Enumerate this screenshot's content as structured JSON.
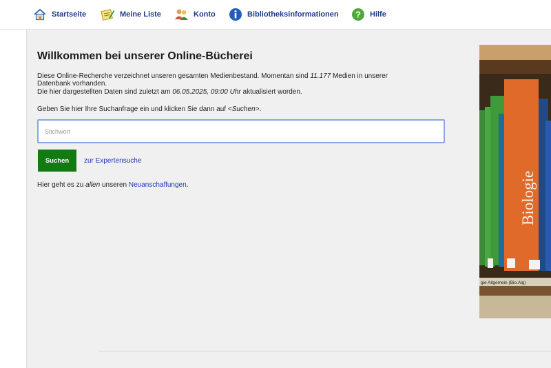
{
  "nav": {
    "items": [
      {
        "label": "Startseite",
        "icon": "home-icon"
      },
      {
        "label": "Meine Liste",
        "icon": "notepad-icon"
      },
      {
        "label": "Konto",
        "icon": "users-icon"
      },
      {
        "label": "Bibliotheksinformationen",
        "icon": "info-icon"
      },
      {
        "label": "Hilfe",
        "icon": "help-icon"
      }
    ]
  },
  "main": {
    "title": "Willkommen bei unserer Online-Bücherei",
    "intro_part1": "Diese Online-Recherche verzeichnet unseren gesamten Medienbestand. Momentan sind ",
    "media_count": "11.177",
    "intro_part2": " Medien in unserer Datenbank vorhanden.",
    "updated_part1": "Die hier dargestellten Daten sind zuletzt am ",
    "updated_datetime": "06.05.2025, 09:00 Uhr",
    "updated_part2": " aktualisiert worden.",
    "instruction_part1": "Geben Sie hier Ihre Suchanfrage ein und klicken Sie dann auf ",
    "instruction_em": "<Suchen>",
    "instruction_part2": ".",
    "search_placeholder": "Stichwort",
    "search_button": "Suchen",
    "expert_link": "zur Expertensuche",
    "new_part1": "Hier geht es zu ",
    "new_em": "allen",
    "new_part2": " unseren ",
    "new_link": "Neuanschaffungen",
    "new_part3": ".",
    "photo_book_title": "Biologie",
    "photo_shelf_label": "gie Allgemein (Bio.Alg)"
  },
  "colors": {
    "nav_text": "#1f3a8a",
    "link": "#1f3ab0",
    "button_bg": "#127a10",
    "content_bg": "#f0f0f0",
    "search_border": "#8aa6e6"
  }
}
